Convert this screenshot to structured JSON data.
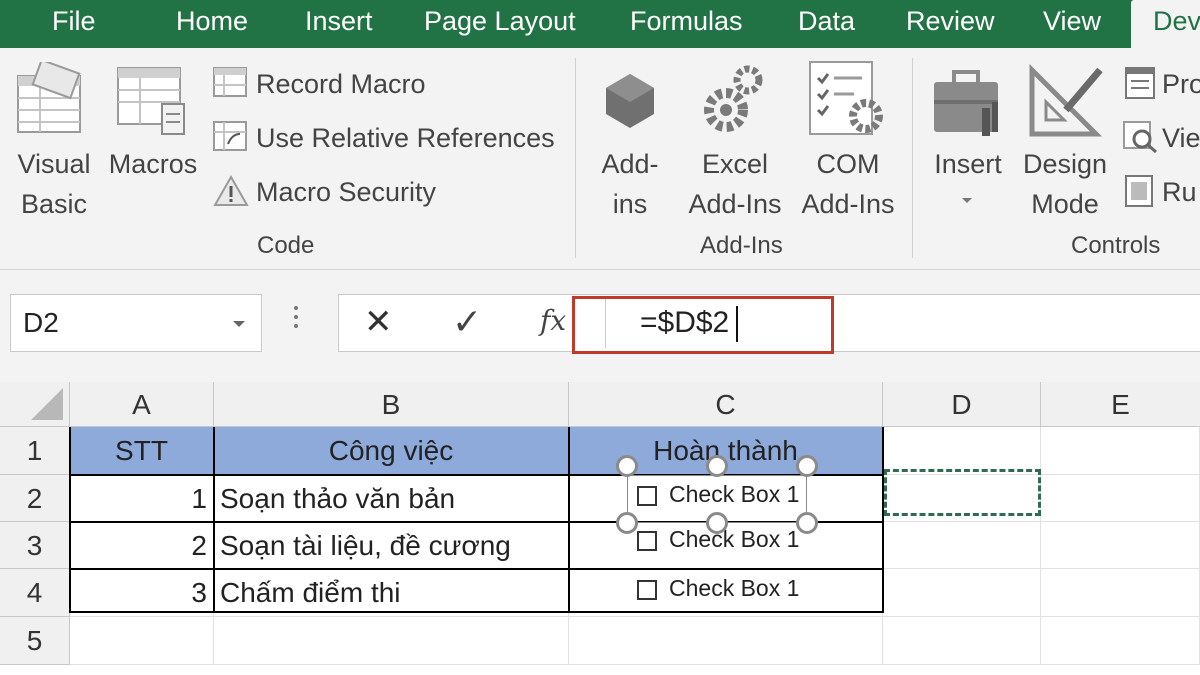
{
  "ribbon_tabs": [
    "File",
    "Home",
    "Insert",
    "Page Layout",
    "Formulas",
    "Data",
    "Review",
    "View",
    "Dev"
  ],
  "active_tab": "Dev",
  "code_group": {
    "visual_basic": [
      "Visual",
      "Basic"
    ],
    "macros": "Macros",
    "record_macro": "Record Macro",
    "use_relative_references": "Use Relative References",
    "macro_security": "Macro Security",
    "label": "Code"
  },
  "addins_group": {
    "addins": [
      "Add-",
      "ins"
    ],
    "excel_addins": [
      "Excel",
      "Add-Ins"
    ],
    "com_addins": [
      "COM",
      "Add-Ins"
    ],
    "label": "Add-Ins"
  },
  "controls_group": {
    "insert": "Insert",
    "design_mode": [
      "Design",
      "Mode"
    ],
    "properties": "Pro",
    "view_code": "Vie",
    "run_dialog": "Ru",
    "label": "Controls"
  },
  "formula_bar": {
    "name_box": "D2",
    "cancel_symbol": "✕",
    "enter_symbol": "✓",
    "fx_label": "fx",
    "formula": "=$D$2"
  },
  "columns": [
    "A",
    "B",
    "C",
    "D",
    "E"
  ],
  "rows": [
    "1",
    "2",
    "3",
    "4",
    "5"
  ],
  "table": {
    "headers": [
      "STT",
      "Công việc",
      "Hoàn thành"
    ],
    "rows": [
      {
        "stt": "1",
        "task": "Soạn thảo văn bản",
        "checkbox": "Check Box 1"
      },
      {
        "stt": "2",
        "task": "Soạn tài liệu, đề cương",
        "checkbox": "Check Box 1"
      },
      {
        "stt": "3",
        "task": "Chấm điểm thi",
        "checkbox": "Check Box 1"
      }
    ]
  },
  "colors": {
    "ribbon_green": "#217346",
    "header_fill": "#8eaadb",
    "highlight_red": "#c0392b"
  }
}
